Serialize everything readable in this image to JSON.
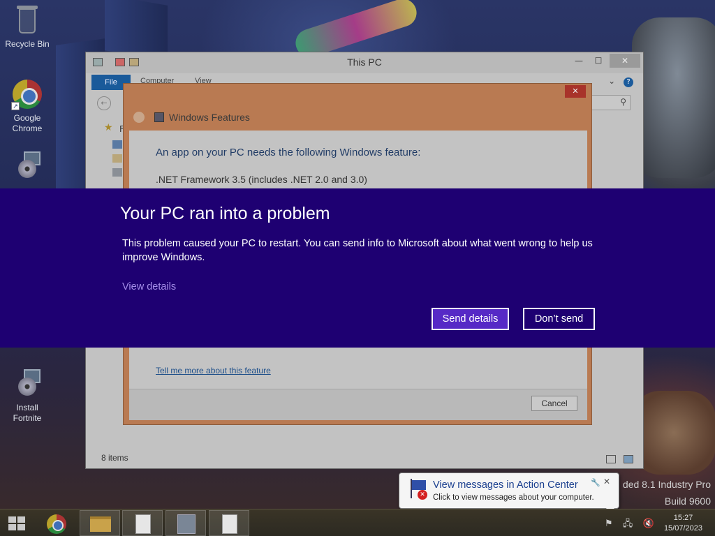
{
  "desktop": {
    "icons": [
      {
        "label": "Recycle Bin",
        "icon": "recycle-bin-icon"
      },
      {
        "label": "Google Chrome",
        "icon": "chrome-icon"
      },
      {
        "label": "Install Fortnite",
        "icon": "installer-icon"
      }
    ]
  },
  "explorer": {
    "title": "This PC",
    "tabs": [
      "File",
      "Computer",
      "View"
    ],
    "nav_letter": "F",
    "status_count": "8 items",
    "accent_color": "#1a5a9a"
  },
  "features_dialog": {
    "title": "Windows Features",
    "heading": "An app on your PC needs the following Windows feature:",
    "feature": ".NET Framework 3.5 (includes .NET 2.0 and 3.0)",
    "link": "Tell me more about this feature",
    "cancel_label": "Cancel",
    "close_glyph": "✕"
  },
  "crash_dialog": {
    "title": "Your PC ran into a problem",
    "message": "This problem caused your PC to restart. You can send info to Microsoft about what went wrong to help us improve Windows.",
    "view_details": "View details",
    "send_label": "Send details",
    "dont_send_label": "Don’t send",
    "background_color": "#1e0072",
    "primary_button_color": "#5629c6"
  },
  "watermark": {
    "line1": "ded 8.1 Industry Pro",
    "line2": "Build 9600"
  },
  "toast": {
    "title": "View messages in Action Center",
    "subtitle": "Click to view messages about your computer.",
    "close_glyph": "✕",
    "wrench_glyph": "🔧"
  },
  "taskbar": {
    "clock_time": "15:27",
    "clock_date": "15/07/2023",
    "buttons": [
      "chrome",
      "file-explorer",
      "document",
      "installer",
      "document"
    ]
  }
}
